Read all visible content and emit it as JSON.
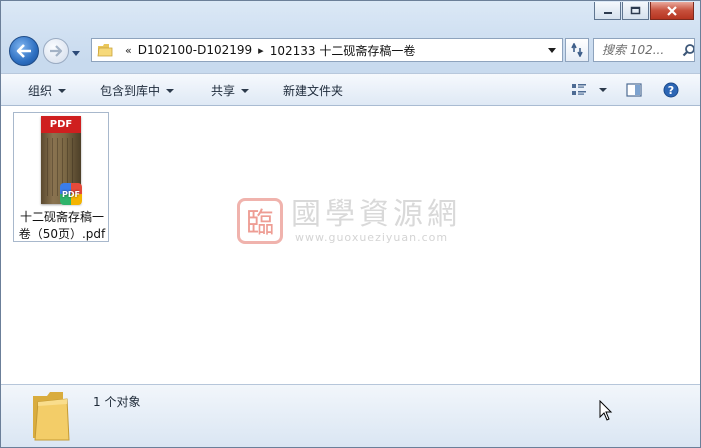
{
  "window": {
    "controls": {
      "minimize_icon": "minimize-icon",
      "maximize_icon": "maximize-icon",
      "close_icon": "close-icon"
    }
  },
  "nav": {
    "breadcrumb_prefix": "«",
    "breadcrumb": [
      "D102100-D102199",
      "102133 十二砚斋存稿一卷"
    ],
    "separator": "▸",
    "search_placeholder": "搜索 102...",
    "icons": [
      "back-arrow-icon",
      "forward-arrow-icon",
      "history-dropdown-icon",
      "folder-icon",
      "chevron-down-icon",
      "refresh-icon",
      "search-icon"
    ]
  },
  "toolbar": {
    "organize": "组织",
    "include_in_library": "包含到库中",
    "share": "共享",
    "new_folder": "新建文件夹",
    "right_icons": [
      "view-options-icon",
      "preview-pane-icon",
      "help-icon"
    ]
  },
  "files": [
    {
      "name": "十二砚斋存稿一卷（50页）.pdf",
      "thumb_label": "PDF",
      "badge_label": "PDF"
    }
  ],
  "watermark": {
    "seal_char": "臨",
    "title": "國學資源網",
    "url": "www.guoxueziyuan.com"
  },
  "details": {
    "count_text": "1 个对象"
  },
  "colors": {
    "chrome_top": "#dbe8f6",
    "toolbar_bg": "#dfe9f5",
    "close_button": "#c7503c",
    "back_button": "#2d6fc1",
    "pdf_red": "#cf1f1f"
  }
}
